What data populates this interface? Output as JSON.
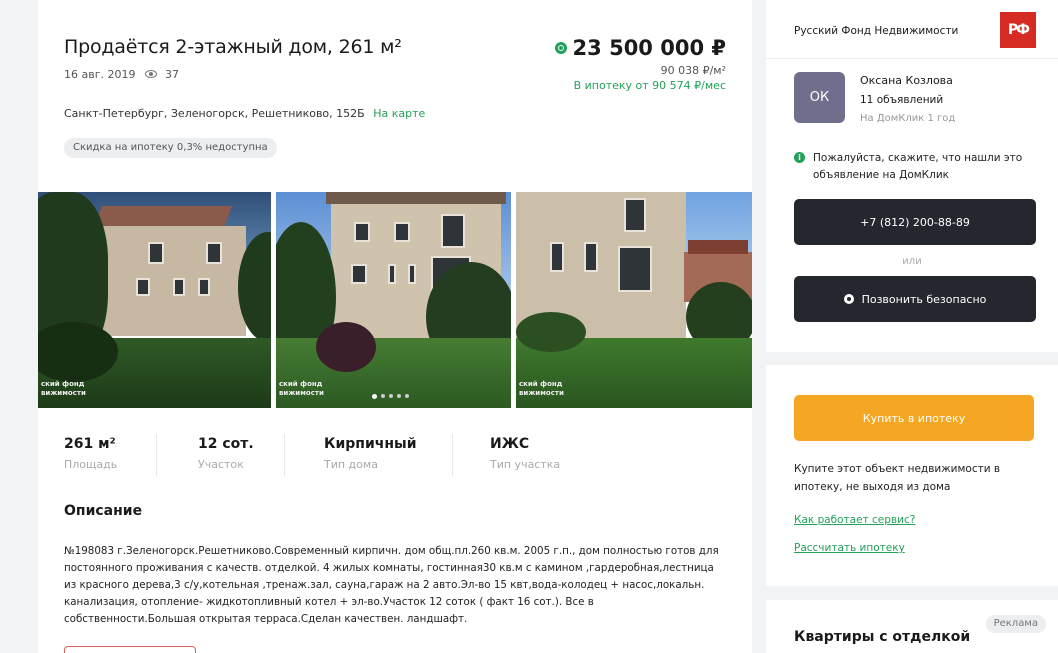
{
  "listing": {
    "title": "Продаётся 2-этажный дом, 261 м²",
    "date": "16 авг. 2019",
    "views": "37",
    "price": "23 500 000 ₽",
    "price_per_m": "90 038 ₽/м²",
    "mortgage_from": "В ипотеку от 90 574 ₽/мес",
    "address": "Санкт-Петербург, Зеленогорск, Решетниково, 152Б",
    "map_link": "На карте",
    "discount_chip": "Скидка на ипотеку 0,3% недоступна",
    "watermark": "ский фонд\nвижимости"
  },
  "facts": [
    {
      "value": "261 м²",
      "label": "Площадь"
    },
    {
      "value": "12 сот.",
      "label": "Участок"
    },
    {
      "value": "Кирпичный",
      "label": "Тип дома"
    },
    {
      "value": "ИЖС",
      "label": "Тип участка"
    }
  ],
  "description": {
    "title": "Описание",
    "text": "№198083 г.Зеленогорск.Решетниково.Современный кирпичн. дом общ.пл.260 кв.м. 2005 г.п., дом полностью готов для постоянного проживания с качеств. отделкой. 4 жилых комнаты, гостинная30 кв.м с камином ,гардеробная,лестница из красного дерева,3 с/у,котельная ,тренаж.зал, сауна,гараж на 2 авто.Эл-во 15 квт,вода-колодец + насос,локальн. канализация, отопление- жидкотопливный котел + эл-во.Участок 12 соток ( факт 16 сот.). Все в собственности.Большая открытая терраса.Сделан качествен. ландшафт."
  },
  "seller": {
    "agency": "Русский Фонд Недвижимости",
    "logo_text": "РФ",
    "avatar_initials": "ОК",
    "agent_name": "Оксана Козлова",
    "agent_listings": "11 объявлений",
    "agent_since": "На ДомКлик 1 год",
    "notice": "Пожалуйста, скажите, что нашли это объявление на ДомКлик",
    "phone": "+7 (812) 200-88-89",
    "or": "или",
    "safe_call": "Позвонить безопасно"
  },
  "mortgage": {
    "button": "Купить в ипотеку",
    "text": "Купите этот объект недвижимости в ипотеку, не выходя из дома",
    "link_how": "Как работает сервис?",
    "link_calc": "Рассчитать ипотеку"
  },
  "ad": {
    "badge": "Реклама",
    "title": "Квартиры с отделкой"
  },
  "colors": {
    "accent_green": "#23a059",
    "orange": "#f5a623",
    "dark_button": "#24282e",
    "logo_red": "#d62b22"
  }
}
